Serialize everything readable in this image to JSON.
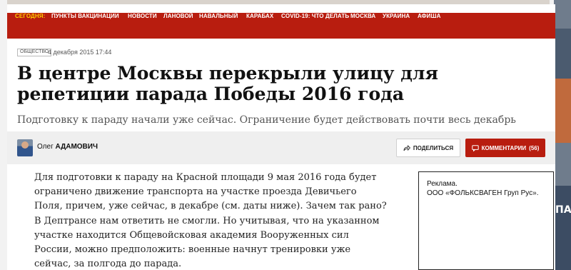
{
  "nav": {
    "today_label": "СЕГОДНЯ:",
    "items": [
      "ПУНКТЫ ВАКЦИНАЦИИ",
      "НОВОСТИ",
      "ЛАНОВОЙ",
      "НАВАЛЬНЫЙ",
      "КАРАБАХ",
      "COVID-19: ЧТО ДЕЛАТЬ",
      "МОСКВА",
      "УКРАИНА",
      "АФИША"
    ]
  },
  "article": {
    "rubric": "ОБЩЕСТВО",
    "date": "4 декабря 2015 17:44",
    "title": "В центре Москвы перекрыли улицу для репетиции парада Победы 2016 года",
    "subtitle": "Подготовку к параду начали уже сейчас. Ограничение будет действовать почти весь декабрь",
    "author_first": "Олег",
    "author_last": "АДАМОВИЧ",
    "share_label": "ПОДЕЛИТЬСЯ",
    "comments_label": "КОММЕНТАРИИ",
    "comments_count": "(56)",
    "body": "Для подготовки к параду на Красной площади 9 мая 2016 года будет ограничено движение транспорта на участке проезда Девичьего Поля, причем, уже сейчас, в декабре (см. даты ниже). Зачем так рано? В Дептрансе нам ответить не смогли. Но учитывая, что на указанном участке находится Общевойсковая академия Вооруженных сил России, можно предположить: военные начнут тренировки уже сейчас, за полгода до парада."
  },
  "ad": {
    "label": "Реклама.",
    "advertiser": "ООО «ФОЛЬКСВАГЕН Груп Рус»."
  },
  "side_ad": {
    "text": "ПА"
  },
  "colors": {
    "brand_red": "#b81d0f",
    "today_yellow": "#ffcc00"
  },
  "icons": {
    "share": "share-icon"
  }
}
